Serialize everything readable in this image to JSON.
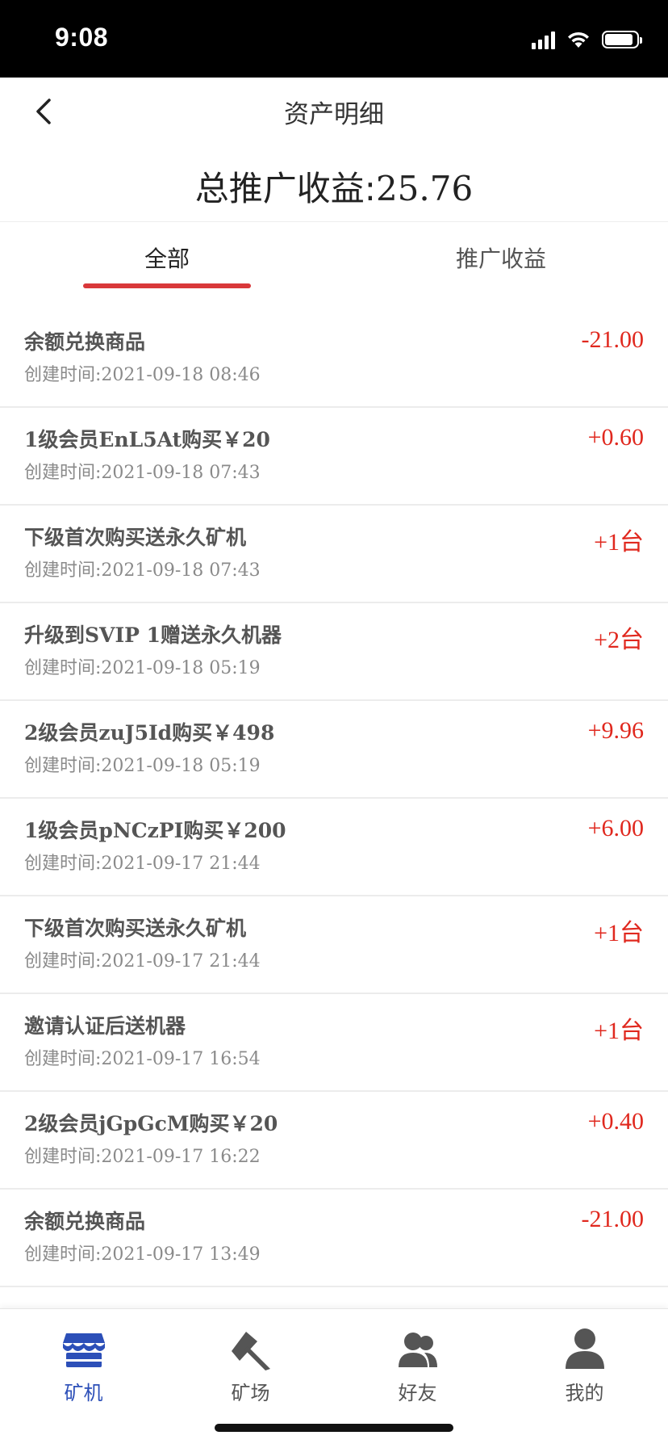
{
  "status_bar": {
    "time": "9:08",
    "battery_level": 0.9
  },
  "nav": {
    "title": "资产明细"
  },
  "summary": {
    "label": "总推广收益:",
    "value": "25.76"
  },
  "tabs": [
    {
      "label": "全部",
      "active": true
    },
    {
      "label": "推广收益",
      "active": false
    }
  ],
  "records": [
    {
      "title": "余额兑换商品",
      "time": "创建时间:2021-09-18 08:46",
      "amount": "-21.00"
    },
    {
      "title": "1级会员EnL5At购买￥20",
      "time": "创建时间:2021-09-18 07:43",
      "amount": "+0.60"
    },
    {
      "title": "下级首次购买送永久矿机",
      "time": "创建时间:2021-09-18 07:43",
      "amount": "+1台"
    },
    {
      "title": "升级到SVIP 1赠送永久机器",
      "time": "创建时间:2021-09-18 05:19",
      "amount": "+2台"
    },
    {
      "title": "2级会员zuJ5Id购买￥498",
      "time": "创建时间:2021-09-18 05:19",
      "amount": "+9.96"
    },
    {
      "title": "1级会员pNCzPI购买￥200",
      "time": "创建时间:2021-09-17 21:44",
      "amount": "+6.00"
    },
    {
      "title": "下级首次购买送永久矿机",
      "time": "创建时间:2021-09-17 21:44",
      "amount": "+1台"
    },
    {
      "title": "邀请认证后送机器",
      "time": "创建时间:2021-09-17 16:54",
      "amount": "+1台"
    },
    {
      "title": "2级会员jGpGcM购买￥20",
      "time": "创建时间:2021-09-17 16:22",
      "amount": "+0.40"
    },
    {
      "title": "余额兑换商品",
      "time": "创建时间:2021-09-17 13:49",
      "amount": "-21.00"
    }
  ],
  "tab_bar": [
    {
      "label": "矿机",
      "icon": "mining-machine-icon",
      "active": true
    },
    {
      "label": "矿场",
      "icon": "pickaxe-icon",
      "active": false
    },
    {
      "label": "好友",
      "icon": "friends-icon",
      "active": false
    },
    {
      "label": "我的",
      "icon": "profile-icon",
      "active": false
    }
  ],
  "colors": {
    "accent": "#d9383a",
    "amount": "#e0281e",
    "tab_active": "#2c4fb8",
    "icon_inactive": "#555555"
  }
}
